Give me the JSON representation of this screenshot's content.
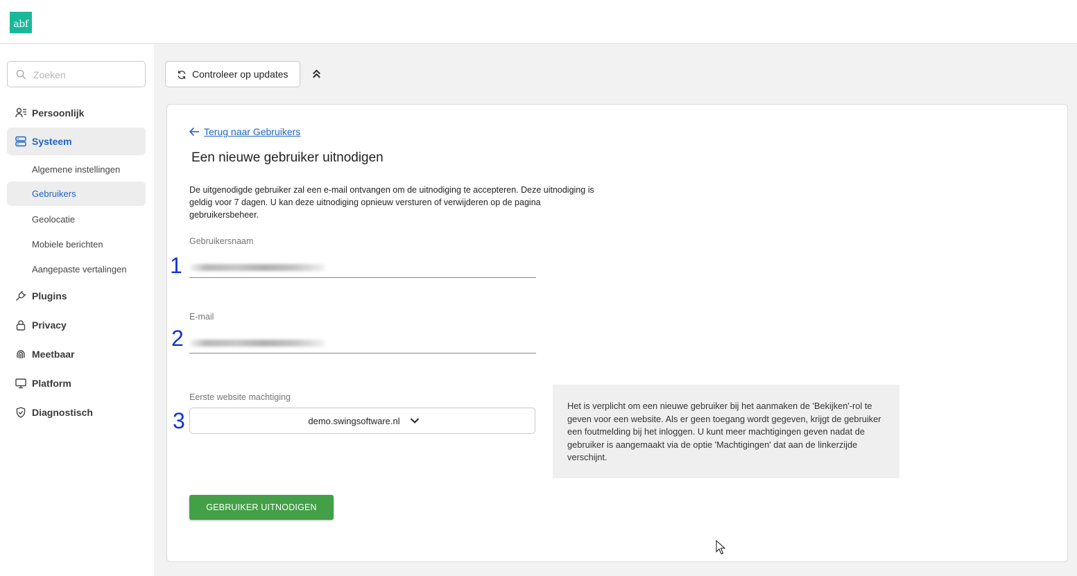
{
  "header": {
    "logo_text": "abf",
    "logo_color": "#19b89b"
  },
  "sidebar": {
    "search_placeholder": "Zoeken",
    "items": [
      {
        "label": "Persoonlijk",
        "icon": "user-list-icon"
      },
      {
        "label": "Systeem",
        "icon": "server-icon",
        "active": true
      },
      {
        "label": "Plugins",
        "icon": "plug-icon"
      },
      {
        "label": "Privacy",
        "icon": "lock-icon"
      },
      {
        "label": "Meetbaar",
        "icon": "fingerprint-icon"
      },
      {
        "label": "Platform",
        "icon": "monitor-icon"
      },
      {
        "label": "Diagnostisch",
        "icon": "shield-check-icon"
      }
    ],
    "subitems": [
      {
        "label": "Algemene instellingen"
      },
      {
        "label": "Gebruikers",
        "active": true
      },
      {
        "label": "Geolocatie"
      },
      {
        "label": "Mobiele berichten"
      },
      {
        "label": "Aangepaste vertalingen"
      }
    ]
  },
  "toolbar": {
    "check_updates_label": "Controleer op updates"
  },
  "form": {
    "back_link": "Terug naar Gebruikers",
    "title": "Een nieuwe gebruiker uitnodigen",
    "description": "De uitgenodigde gebruiker zal een e-mail ontvangen om de uitnodiging te accepteren. Deze uitnodiging is geldig voor 7 dagen. U kan deze uitnodiging opnieuw versturen of verwijderen op de pagina gebruikersbeheer.",
    "username_label": "Gebruikersnaam",
    "email_label": "E-mail",
    "permission_label": "Eerste website machtiging",
    "permission_value": "demo.swingsoftware.nl",
    "info_text": "Het is verplicht om een nieuwe gebruiker bij het aanmaken de 'Bekijken'-rol te geven voor een website. Als er geen toegang wordt gegeven, krijgt de gebruiker een foutmelding bij het inloggen. U kunt meer machtigingen geven nadat de gebruiker is aangemaakt via de optie 'Machtigingen' dat aan de linkerzijde verschijnt.",
    "submit_label": "GEBRUIKER UITNODIGEN",
    "submit_color": "#43a047"
  },
  "annotations": {
    "step1": "1",
    "step2": "2",
    "step3": "3",
    "color": "#1435d8"
  },
  "theme": {
    "accent": "#1f63c6"
  }
}
